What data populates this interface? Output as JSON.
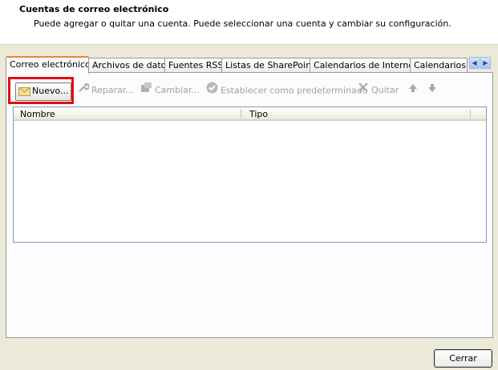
{
  "header": {
    "title": "Cuentas de correo electrónico",
    "subtitle": "Puede agregar o quitar una cuenta. Puede seleccionar una cuenta y cambiar su configuración."
  },
  "tabs": [
    {
      "label": "Correo electrónico",
      "active": true
    },
    {
      "label": "Archivos de datos",
      "active": false
    },
    {
      "label": "Fuentes RSS",
      "active": false
    },
    {
      "label": "Listas de SharePoint",
      "active": false
    },
    {
      "label": "Calendarios de Internet",
      "active": false
    },
    {
      "label": "Calendarios p",
      "active": false
    }
  ],
  "toolbar": {
    "new_label": "Nuevo...",
    "repair_label": "Reparar...",
    "change_label": "Cambiar...",
    "default_label": "Establecer como predeterminado",
    "remove_label": "Quitar"
  },
  "list": {
    "columns": [
      "Nombre",
      "Tipo"
    ],
    "rows": []
  },
  "footer": {
    "close_label": "Cerrar"
  },
  "colors": {
    "highlight": "#e01010",
    "active_tab_accent": "#e68b2c"
  }
}
